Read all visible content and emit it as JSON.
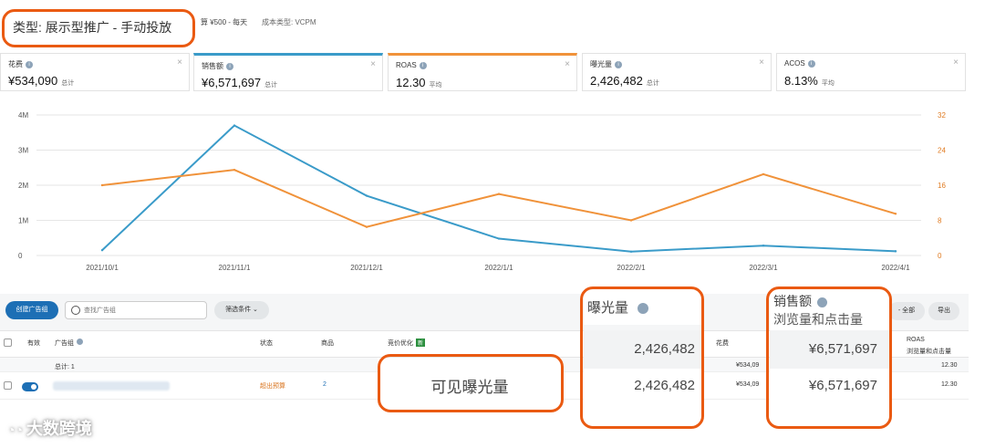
{
  "header": {
    "type_label": "类型: 展示型推广 - 手动投放",
    "budget": "算 ¥500 - 每天",
    "cost_type": "成本类型: VCPM"
  },
  "metrics": [
    {
      "label": "花费",
      "value": "¥534,090",
      "unit": "总计"
    },
    {
      "label": "销售额",
      "value": "¥6,571,697",
      "unit": "总计"
    },
    {
      "label": "ROAS",
      "value": "12.30",
      "unit": "平均"
    },
    {
      "label": "曝光量",
      "value": "2,426,482",
      "unit": "总计"
    },
    {
      "label": "ACOS",
      "value": "8.13%",
      "unit": "平均"
    }
  ],
  "chart_data": {
    "type": "line",
    "x": [
      "2021/10/1",
      "2021/11/1",
      "2021/12/1",
      "2022/1/1",
      "2022/2/1",
      "2022/3/1",
      "2022/4/1"
    ],
    "left_ticks": [
      "4M",
      "3M",
      "2M",
      "1M",
      "0"
    ],
    "right_ticks": [
      "32",
      "24",
      "16",
      "8",
      "0"
    ],
    "ylim_left": [
      0,
      4000000
    ],
    "ylim_right": [
      0,
      32
    ],
    "series": [
      {
        "axis": "left",
        "color": "#3a9bc9",
        "values": [
          150000,
          3700000,
          1700000,
          480000,
          110000,
          280000,
          120000
        ]
      },
      {
        "axis": "right",
        "color": "#f0923a",
        "values": [
          16,
          19.5,
          6.5,
          14,
          8,
          18.5,
          9.5
        ]
      }
    ],
    "grid": true
  },
  "toolbar": {
    "create_label": "创建广告组",
    "search_placeholder": "查找广告组",
    "filter_label": "筛选条件",
    "all_label": "- 全部",
    "export_label": "导出"
  },
  "table": {
    "headers": {
      "active": "有效",
      "adgroup": "广告组",
      "status": "状态",
      "products": "商品",
      "bid_opt": "竞价优化",
      "new_badge": "新",
      "spend": "花费",
      "roas": "ROAS",
      "roas_sub": "浏览量和点击量"
    },
    "total_row": {
      "label": "总计: 1",
      "spend": "¥534,09",
      "roas": "12.30"
    },
    "row": {
      "status": "超出预算",
      "products": "2",
      "spend": "¥534,09",
      "roas": "12.30"
    }
  },
  "overlays": {
    "impressions_title": "曝光量",
    "impressions_total": "2,426,482",
    "impressions_row": "2,426,482",
    "visible_impressions": "可见曝光量",
    "sales_title": "销售额",
    "sales_sub": "浏览量和点击量",
    "sales_total": "¥6,571,697",
    "sales_row": "¥6,571,697"
  },
  "watermark": "大数跨境"
}
